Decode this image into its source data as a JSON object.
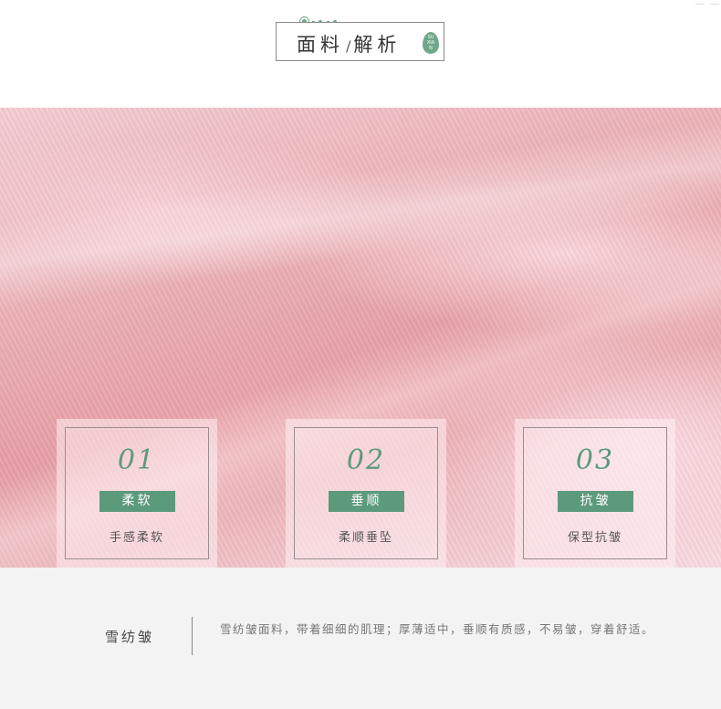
{
  "header": {
    "title_part1": "面料",
    "title_slash": "/",
    "title_part2": "解析",
    "badge_text": "SU XIAN"
  },
  "colors": {
    "accent_green": "#5c9a7c",
    "fabric_pink": "#e9aeb4",
    "footer_bg": "#f3f3f3"
  },
  "features": [
    {
      "number": "01",
      "tag": "柔软",
      "description": "手感柔软"
    },
    {
      "number": "02",
      "tag": "垂顺",
      "description": "柔顺垂坠"
    },
    {
      "number": "03",
      "tag": "抗皱",
      "description": "保型抗皱"
    }
  ],
  "footer": {
    "label": "雪纺皱",
    "description": "雪纺皱面料，带着细细的肌理；厚薄适中，垂顺有质感，不易皱，穿着舒适。"
  }
}
